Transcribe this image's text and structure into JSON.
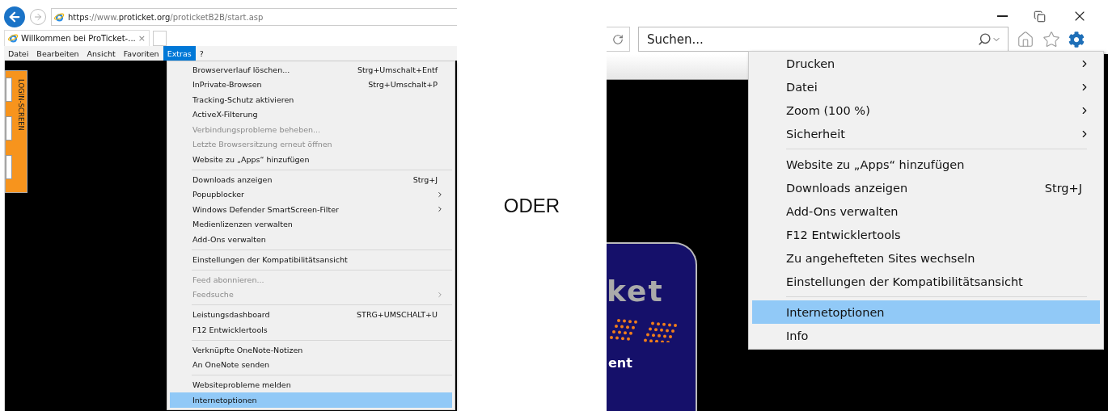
{
  "left": {
    "address": {
      "url": "**https**://www.**proticket.org**/proticketB2B/start.asp"
    },
    "tab": {
      "title": "Willkommen bei ProTicket-...",
      "close": "×"
    },
    "menubar": [
      {
        "label": "Datei",
        "selected": false
      },
      {
        "label": "Bearbeiten",
        "selected": false
      },
      {
        "label": "Ansicht",
        "selected": false
      },
      {
        "label": "Favoriten",
        "selected": false
      },
      {
        "label": "Extras",
        "selected": true
      },
      {
        "label": "?",
        "selected": false
      }
    ],
    "login_panel": {
      "label": "LOGIN-SCREEN"
    },
    "menu": [
      {
        "kind": "item",
        "label": "Browserverlauf löschen...",
        "shortcut": "Strg+Umschalt+Entf",
        "submenu": false,
        "disabled": false,
        "selected": false
      },
      {
        "kind": "item",
        "label": "InPrivate-Browsen",
        "shortcut": "Strg+Umschalt+P",
        "submenu": false,
        "disabled": false,
        "selected": false
      },
      {
        "kind": "item",
        "label": "Tracking-Schutz aktivieren",
        "submenu": false,
        "disabled": false,
        "selected": false
      },
      {
        "kind": "item",
        "label": "ActiveX-Filterung",
        "submenu": false,
        "disabled": false,
        "selected": false
      },
      {
        "kind": "item",
        "label": "Verbindungsprobleme beheben...",
        "submenu": false,
        "disabled": true,
        "selected": false
      },
      {
        "kind": "item",
        "label": "Letzte Browsersitzung erneut öffnen",
        "submenu": false,
        "disabled": true,
        "selected": false
      },
      {
        "kind": "item",
        "label": "Website zu „Apps“ hinzufügen",
        "submenu": false,
        "disabled": false,
        "selected": false
      },
      {
        "kind": "separator"
      },
      {
        "kind": "item",
        "label": "Downloads anzeigen",
        "shortcut": "Strg+J",
        "submenu": false,
        "disabled": false,
        "selected": false
      },
      {
        "kind": "item",
        "label": "Popupblocker",
        "submenu": true,
        "disabled": false,
        "selected": false
      },
      {
        "kind": "item",
        "label": "Windows Defender SmartScreen-Filter",
        "submenu": true,
        "disabled": false,
        "selected": false
      },
      {
        "kind": "item",
        "label": "Medienlizenzen verwalten",
        "submenu": false,
        "disabled": false,
        "selected": false
      },
      {
        "kind": "item",
        "label": "Add-Ons verwalten",
        "submenu": false,
        "disabled": false,
        "selected": false
      },
      {
        "kind": "separator"
      },
      {
        "kind": "item",
        "label": "Einstellungen der Kompatibilitätsansicht",
        "submenu": false,
        "disabled": false,
        "selected": false
      },
      {
        "kind": "separator"
      },
      {
        "kind": "item",
        "label": "Feed abonnieren...",
        "submenu": false,
        "disabled": true,
        "selected": false
      },
      {
        "kind": "item",
        "label": "Feedsuche",
        "submenu": true,
        "disabled": true,
        "selected": false
      },
      {
        "kind": "separator"
      },
      {
        "kind": "item",
        "label": "Leistungsdashboard",
        "shortcut": "STRG+UMSCHALT+U",
        "submenu": false,
        "disabled": false,
        "selected": false
      },
      {
        "kind": "item",
        "label": "F12 Entwicklertools",
        "submenu": false,
        "disabled": false,
        "selected": false
      },
      {
        "kind": "separator"
      },
      {
        "kind": "item",
        "label": "Verknüpfte OneNote-Notizen",
        "submenu": false,
        "disabled": false,
        "selected": false
      },
      {
        "kind": "item",
        "label": "An OneNote senden",
        "submenu": false,
        "disabled": false,
        "selected": false
      },
      {
        "kind": "separator"
      },
      {
        "kind": "item",
        "label": "Websiteprobleme melden",
        "submenu": false,
        "disabled": false,
        "selected": false
      },
      {
        "kind": "item",
        "label": "Internetoptionen",
        "submenu": false,
        "disabled": false,
        "selected": true
      }
    ]
  },
  "divider_text": "ODER",
  "right": {
    "search": {
      "placeholder": "Suchen..."
    },
    "logo": {
      "wordmark": "ket",
      "tagline": "ent"
    },
    "menu": [
      {
        "kind": "item",
        "label": "Drucken",
        "submenu": true,
        "selected": false
      },
      {
        "kind": "item",
        "label": "Datei",
        "submenu": true,
        "selected": false
      },
      {
        "kind": "item",
        "label": "Zoom (100 %)",
        "submenu": true,
        "selected": false
      },
      {
        "kind": "item",
        "label": "Sicherheit",
        "submenu": true,
        "selected": false
      },
      {
        "kind": "separator"
      },
      {
        "kind": "item",
        "label": "Website zu „Apps“ hinzufügen",
        "submenu": false,
        "selected": false
      },
      {
        "kind": "item",
        "label": "Downloads anzeigen",
        "shortcut": "Strg+J",
        "submenu": false,
        "selected": false
      },
      {
        "kind": "item",
        "label": "Add-Ons verwalten",
        "submenu": false,
        "selected": false
      },
      {
        "kind": "item",
        "label": "F12 Entwicklertools",
        "submenu": false,
        "selected": false
      },
      {
        "kind": "item",
        "label": "Zu angehefteten Sites wechseln",
        "submenu": false,
        "selected": false
      },
      {
        "kind": "item",
        "label": "Einstellungen der Kompatibilitätsansicht",
        "submenu": false,
        "selected": false
      },
      {
        "kind": "separator"
      },
      {
        "kind": "item",
        "label": "Internetoptionen",
        "submenu": false,
        "selected": true
      },
      {
        "kind": "item",
        "label": "Info",
        "submenu": false,
        "selected": false
      }
    ]
  }
}
